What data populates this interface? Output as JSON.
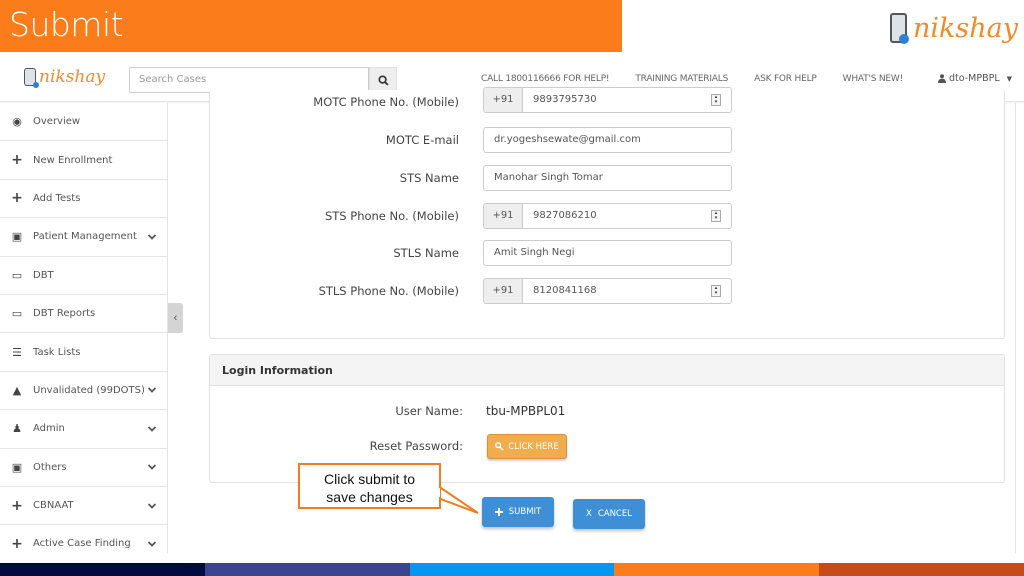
{
  "slide": {
    "title": "Submit",
    "brand": "nikshay"
  },
  "header": {
    "brand": "nikshay",
    "search_placeholder": "Search Cases",
    "nav_links": [
      "CALL 1800116666 FOR HELP!",
      "TRAINING MATERIALS",
      "ASK FOR HELP",
      "WHAT'S NEW!"
    ],
    "user": "dto-MPBPL"
  },
  "sidebar": {
    "items": [
      {
        "label": "Overview",
        "icon": "dashboard-icon",
        "glyph": "◉",
        "expandable": false
      },
      {
        "label": "New Enrollment",
        "icon": "plus-icon",
        "glyph": "+",
        "expandable": false
      },
      {
        "label": "Add Tests",
        "icon": "plus-icon",
        "glyph": "+",
        "expandable": false
      },
      {
        "label": "Patient Management",
        "icon": "medkit-icon",
        "glyph": "▣",
        "expandable": true
      },
      {
        "label": "DBT",
        "icon": "money-icon",
        "glyph": "▭",
        "expandable": false
      },
      {
        "label": "DBT Reports",
        "icon": "money-icon",
        "glyph": "▭",
        "expandable": false
      },
      {
        "label": "Task Lists",
        "icon": "list-icon",
        "glyph": "☰",
        "expandable": false
      },
      {
        "label": "Unvalidated (99DOTS)",
        "icon": "warning-icon",
        "glyph": "▲",
        "expandable": true
      },
      {
        "label": "Admin",
        "icon": "user-icon",
        "glyph": "♟",
        "expandable": true
      },
      {
        "label": "Others",
        "icon": "medkit-icon",
        "glyph": "▣",
        "expandable": true
      },
      {
        "label": "CBNAAT",
        "icon": "plus-icon",
        "glyph": "+",
        "expandable": true
      },
      {
        "label": "Active Case Finding",
        "icon": "plus-icon",
        "glyph": "+",
        "expandable": true
      }
    ],
    "collapse_glyph": "‹"
  },
  "form": {
    "motc_phone": {
      "label": "MOTC Phone No. (Mobile)",
      "prefix": "+91",
      "value": "9893795730"
    },
    "motc_email": {
      "label": "MOTC E-mail",
      "value": "dr.yogeshsewate@gmail.com"
    },
    "sts_name": {
      "label": "STS Name",
      "value": "Manohar Singh Tomar"
    },
    "sts_phone": {
      "label": "STS Phone No. (Mobile)",
      "prefix": "+91",
      "value": "9827086210"
    },
    "stls_name": {
      "label": "STLS Name",
      "value": "Amit Singh Negi"
    },
    "stls_phone": {
      "label": "STLS Phone No. (Mobile)",
      "prefix": "+91",
      "value": "8120841168"
    }
  },
  "login": {
    "heading": "Login Information",
    "username_label": "User Name:",
    "username": "tbu-MPBPL01",
    "reset_label": "Reset Password:",
    "reset_button": "CLICK HERE"
  },
  "actions": {
    "submit": "SUBMIT",
    "cancel": "CANCEL",
    "cancel_glyph": "X"
  },
  "callout": {
    "text_line1": "Click submit to",
    "text_line2": "save changes"
  },
  "colors": {
    "accent_orange": "#fb7c1a",
    "primary_blue": "#3f8fd6",
    "warning": "#f0ad4e",
    "footer": [
      "#020b40",
      "#3b4491",
      "#0497f2",
      "#fb7c1a",
      "#c64a1a"
    ]
  }
}
